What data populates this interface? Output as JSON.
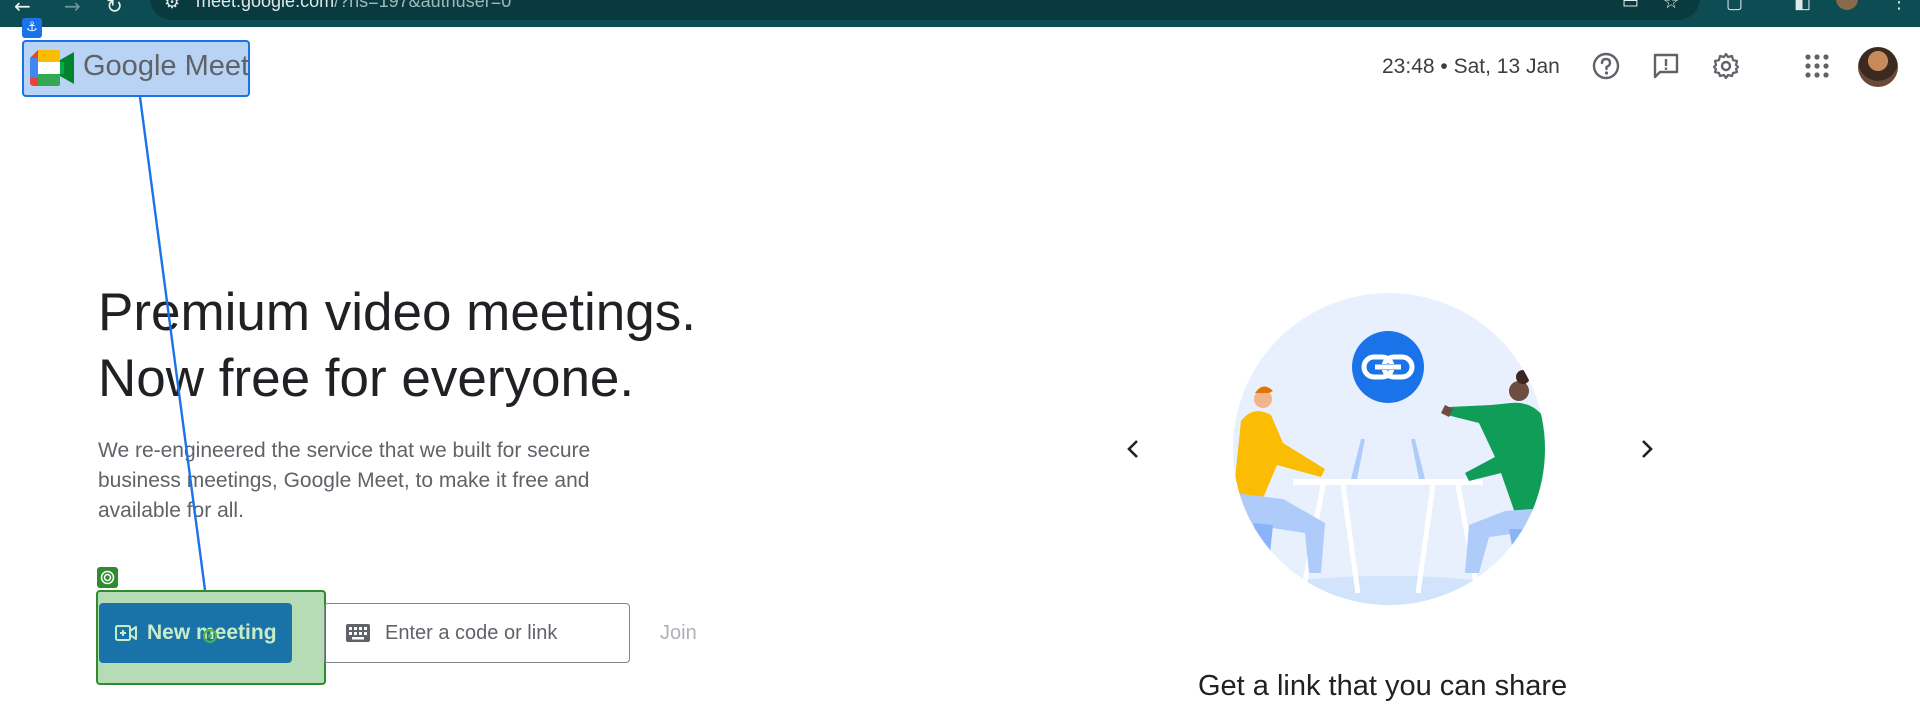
{
  "browser": {
    "url_host": "meet.google.com",
    "url_rest": "/?hs=197&authuser=0"
  },
  "header": {
    "logo_google": "Google",
    "logo_meet": "Meet",
    "datetime": "23:48 • Sat, 13 Jan"
  },
  "hero": {
    "headline_line1": "Premium video meetings.",
    "headline_line2": "Now free for everyone.",
    "description": "We re-engineered the service that we built for secure business meetings, Google Meet, to make it free and available for all."
  },
  "actions": {
    "new_meeting_label": "New meeting",
    "code_placeholder": "Enter a code or link",
    "join_label": "Join"
  },
  "carousel": {
    "caption": "Get a link that you can share"
  },
  "colors": {
    "chrome_bg": "#0d4c52",
    "new_meeting_bg": "#1a73a8",
    "logo_highlight": "#b9d3f4",
    "selection_highlight": "#b6dcb6"
  }
}
